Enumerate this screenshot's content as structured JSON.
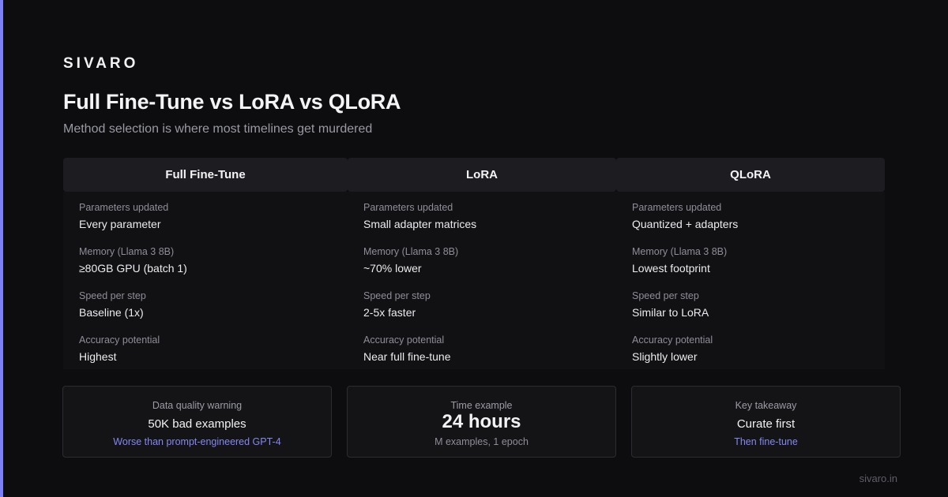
{
  "brand": "SIVARO",
  "title": "Full Fine-Tune vs LoRA vs QLoRA",
  "subtitle": "Method selection is where most timelines get murdered",
  "columns": [
    {
      "header": "Full Fine-Tune",
      "rows": [
        {
          "label": "Parameters updated",
          "value": "Every parameter"
        },
        {
          "label": "Memory (Llama 3 8B)",
          "value": "≥80GB GPU (batch 1)"
        },
        {
          "label": "Speed per step",
          "value": "Baseline (1x)"
        },
        {
          "label": "Accuracy potential",
          "value": "Highest"
        }
      ]
    },
    {
      "header": "LoRA",
      "rows": [
        {
          "label": "Parameters updated",
          "value": "Small adapter matrices"
        },
        {
          "label": "Memory (Llama 3 8B)",
          "value": "~70% lower"
        },
        {
          "label": "Speed per step",
          "value": "2-5x faster"
        },
        {
          "label": "Accuracy potential",
          "value": "Near full fine-tune"
        }
      ]
    },
    {
      "header": "QLoRA",
      "rows": [
        {
          "label": "Parameters updated",
          "value": "Quantized + adapters"
        },
        {
          "label": "Memory (Llama 3 8B)",
          "value": "Lowest footprint"
        },
        {
          "label": "Speed per step",
          "value": "Similar to LoRA"
        },
        {
          "label": "Accuracy potential",
          "value": "Slightly lower"
        }
      ]
    }
  ],
  "cards": [
    {
      "label": "Data quality warning",
      "value": "50K bad examples",
      "note": "Worse than prompt-engineered GPT-4"
    },
    {
      "label": "Time example",
      "value": "24 hours",
      "note": "M examples, 1 epoch"
    },
    {
      "label": "Key takeaway",
      "value": "Curate first",
      "note": "Then fine-tune"
    }
  ],
  "footer": "sivaro.in",
  "colors": {
    "accent": "#7c7ff5",
    "background": "#0d0d0f",
    "note_accent": "#8487f2"
  }
}
